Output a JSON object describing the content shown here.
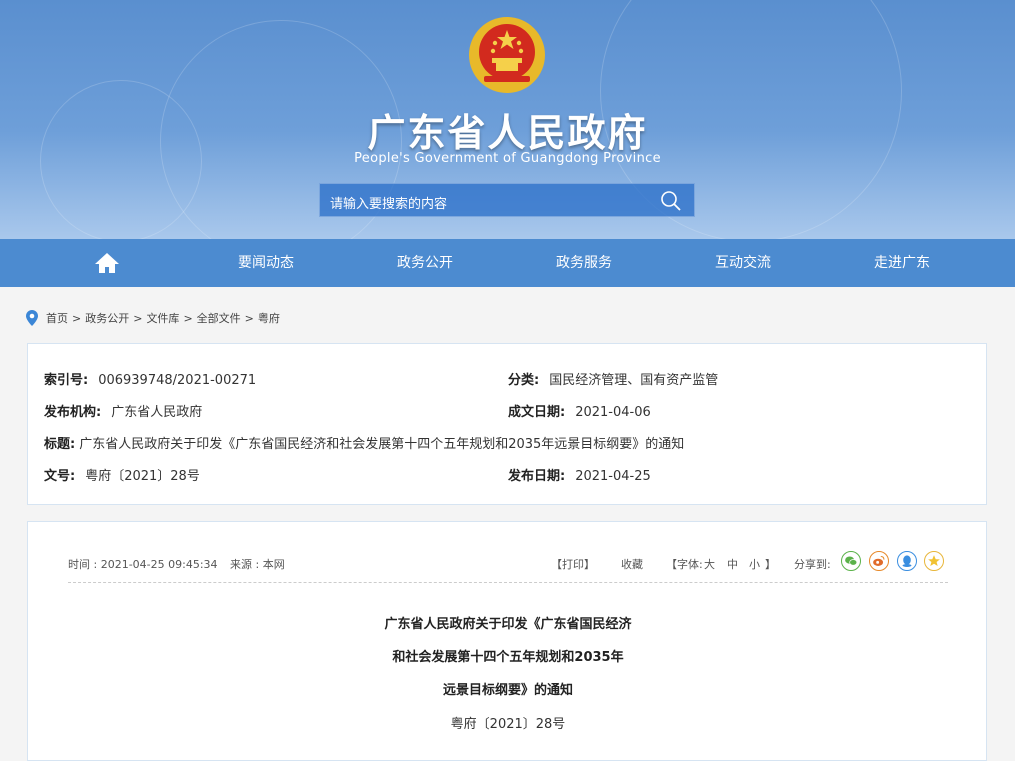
{
  "header": {
    "title": "广东省人民政府",
    "subtitle": "People's Government of Guangdong Province",
    "search_placeholder": "请输入要搜索的内容"
  },
  "nav": {
    "items": [
      "要闻动态",
      "政务公开",
      "政务服务",
      "互动交流",
      "走进广东"
    ]
  },
  "breadcrumb": [
    "首页",
    "政务公开",
    "文件库",
    "全部文件",
    "粤府"
  ],
  "info": {
    "index_label": "索引号:",
    "index_value": "006939748/2021-00271",
    "category_label": "分类:",
    "category_value": "国民经济管理、国有资产监管",
    "publisher_label": "发布机构:",
    "publisher_value": "广东省人民政府",
    "created_label": "成文日期:",
    "created_value": "2021-04-06",
    "title_label": "标题:",
    "title_value": "广东省人民政府关于印发《广东省国民经济和社会发展第十四个五年规划和2035年远景目标纲要》的通知",
    "docno_label": "文号:",
    "docno_value": "粤府〔2021〕28号",
    "published_label": "发布日期:",
    "published_value": "2021-04-25"
  },
  "article": {
    "time": "时间 : 2021-04-25 09:45:34",
    "source": "来源 : 本网",
    "print": "【打印】",
    "favorite": "收藏",
    "font_open": "【字体:",
    "font_large": "大",
    "font_medium": "中",
    "font_small": "小",
    "font_close": "】",
    "share_label": "分享到:",
    "headline": [
      "广东省人民政府关于印发《广东省国民经济",
      "和社会发展第十四个五年规划和2035年",
      "远景目标纲要》的通知"
    ],
    "doc_no": "粤府〔2021〕28号"
  },
  "colors": {
    "nav": "#4c8bd0",
    "banner": "#6e9fd9",
    "accent_red": "#d22a1e",
    "gold": "#f1c232"
  }
}
